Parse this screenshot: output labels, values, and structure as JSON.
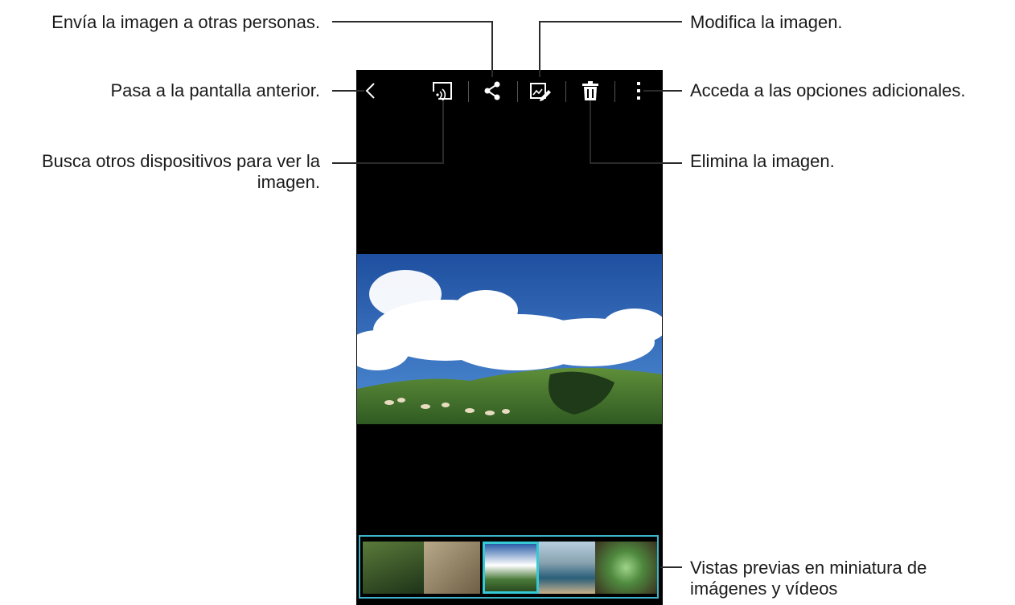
{
  "callouts": {
    "share": "Envía la imagen a otras personas.",
    "back": "Pasa a la pantalla anterior.",
    "cast_line1": "Busca otros dispositivos para ver la",
    "cast_line2": "imagen.",
    "edit": "Modifica la imagen.",
    "more": "Acceda a las opciones adicionales.",
    "delete": "Elimina la imagen.",
    "thumbs_line1": "Vistas previas en miniatura de",
    "thumbs_line2": "imágenes y vídeos"
  },
  "toolbar": {
    "icons": [
      "back-icon",
      "cast-icon",
      "share-icon",
      "edit-icon",
      "delete-icon",
      "more-icon"
    ],
    "icon_color": "#ffffff"
  },
  "thumbnails": {
    "count": 5,
    "selected_index": 2,
    "accent_color": "#36c9d6"
  }
}
